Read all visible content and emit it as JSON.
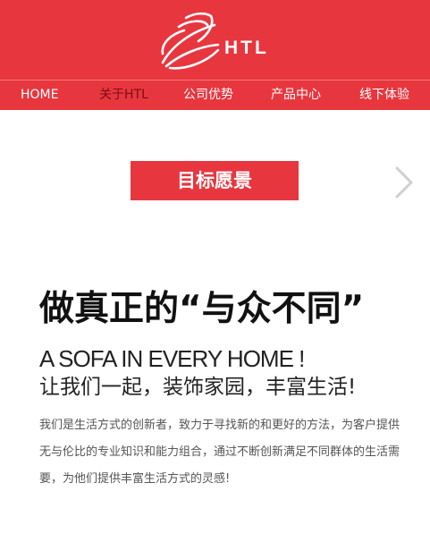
{
  "brand": {
    "logo_text": "HTL",
    "logo_icon": "wing-swoosh-icon",
    "brand_color": "#e8363f"
  },
  "nav": {
    "items": [
      {
        "label": "HOME",
        "active": false
      },
      {
        "label": "关于HTL",
        "active": true
      },
      {
        "label": "公司优势",
        "active": false
      },
      {
        "label": "产品中心",
        "active": false
      },
      {
        "label": "线下体验",
        "active": false
      }
    ]
  },
  "section": {
    "title": "目标愿景",
    "next_icon": "chevron-right-icon"
  },
  "content": {
    "headline": "做真正的“与众不同”",
    "slogan_en": "A SOFA IN EVERY HOME !",
    "slogan_cn": "让我们一起，装饰家园，丰富生活!",
    "description": "我们是生活方式的创新者，致力于寻找新的和更好的方法，为客户提供无与伦比的专业知识和能力组合，通过不断创新满足不同群体的生活需要，为他们提供丰富生活方式的灵感!"
  }
}
